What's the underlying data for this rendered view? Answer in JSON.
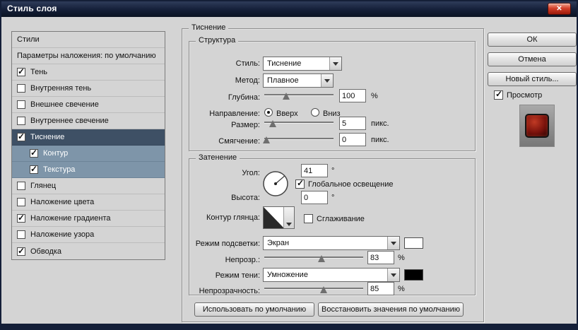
{
  "window": {
    "title": "Стиль слоя",
    "close_glyph": "✕"
  },
  "colors": {
    "selected_item_bg": "#3e5065",
    "sub_item_bg": "#7e95a9",
    "titlebar_bg": "#15203a",
    "highlight_swatch": "#ffffff",
    "shadow_swatch": "#000000"
  },
  "styles_panel": {
    "items": [
      {
        "label": "Стили",
        "check": ""
      },
      {
        "label": "Параметры наложения: по умолчанию",
        "check": ""
      },
      {
        "label": "Тень",
        "check": "✓"
      },
      {
        "label": "Внутренняя тень",
        "check": ""
      },
      {
        "label": "Внешнее свечение",
        "check": ""
      },
      {
        "label": "Внутреннее свечение",
        "check": ""
      },
      {
        "label": "Тиснение",
        "check": "✓"
      },
      {
        "label": "Контур",
        "check": "✓"
      },
      {
        "label": "Текстура",
        "check": "✓"
      },
      {
        "label": "Глянец",
        "check": ""
      },
      {
        "label": "Наложение цвета",
        "check": ""
      },
      {
        "label": "Наложение градиента",
        "check": "✓"
      },
      {
        "label": "Наложение узора",
        "check": ""
      },
      {
        "label": "Обводка",
        "check": "✓"
      }
    ]
  },
  "bevel": {
    "group_title": "Тиснение",
    "structure": {
      "title": "Структура",
      "style_label": "Стиль:",
      "style_value": "Тиснение",
      "method_label": "Метод:",
      "method_value": "Плавное",
      "depth_label": "Глубина:",
      "depth_value": "100",
      "depth_unit": "%",
      "direction_label": "Направление:",
      "direction_up": "Вверх",
      "direction_down": "Вниз",
      "size_label": "Размер:",
      "size_value": "5",
      "size_unit": "пикс.",
      "soften_label": "Смягчение:",
      "soften_value": "0",
      "soften_unit": "пикс."
    },
    "shading": {
      "title": "Затенение",
      "angle_label": "Угол:",
      "angle_value": "41",
      "angle_unit": "°",
      "global_light_label": "Глобальное освещение",
      "altitude_label": "Высота:",
      "altitude_value": "0",
      "altitude_unit": "°",
      "gloss_contour_label": "Контур глянца:",
      "antialias_label": "Сглаживание",
      "highlight_mode_label": "Режим подсветки:",
      "highlight_mode_value": "Экран",
      "highlight_opacity_label": "Непрозр.:",
      "highlight_opacity_value": "83",
      "highlight_opacity_unit": "%",
      "shadow_mode_label": "Режим тени:",
      "shadow_mode_value": "Умножение",
      "shadow_opacity_label": "Непрозрачность:",
      "shadow_opacity_value": "85",
      "shadow_opacity_unit": "%"
    },
    "footer_buttons": {
      "use_defaults": "Использовать по умолчанию",
      "reset_defaults": "Восстановить значения по умолчанию"
    }
  },
  "actions": {
    "ok": "ОК",
    "cancel": "Отмена",
    "new_style": "Новый стиль...",
    "preview_label": "Просмотр"
  }
}
